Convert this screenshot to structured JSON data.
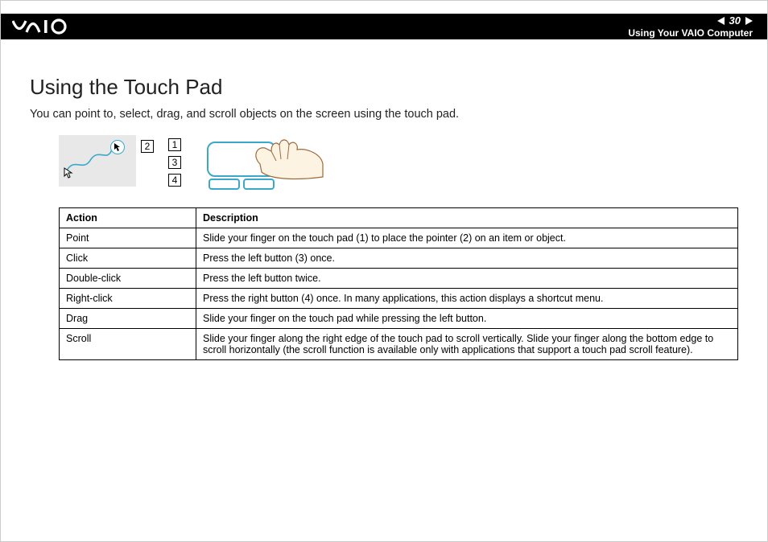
{
  "header": {
    "logo_alt": "VAIO",
    "page_number": "30",
    "breadcrumb": "Using Your VAIO Computer"
  },
  "page": {
    "title": "Using the Touch Pad",
    "intro": "You can point to, select, drag, and scroll objects on the screen using the touch pad."
  },
  "callouts": {
    "c1": "1",
    "c2": "2",
    "c3": "3",
    "c4": "4"
  },
  "table": {
    "headers": {
      "action": "Action",
      "description": "Description"
    },
    "rows": [
      {
        "action": "Point",
        "description": "Slide your finger on the touch pad (1) to place the pointer (2) on an item or object."
      },
      {
        "action": "Click",
        "description": "Press the left button (3) once."
      },
      {
        "action": "Double-click",
        "description": "Press the left button twice."
      },
      {
        "action": "Right-click",
        "description": "Press the right button (4) once. In many applications, this action displays a shortcut menu."
      },
      {
        "action": "Drag",
        "description": "Slide your finger on the touch pad while pressing the left button."
      },
      {
        "action": "Scroll",
        "description": "Slide your finger along the right edge of the touch pad to scroll vertically. Slide your finger along the bottom edge to scroll horizontally (the scroll function is available only with applications that support a touch pad scroll feature)."
      }
    ]
  }
}
